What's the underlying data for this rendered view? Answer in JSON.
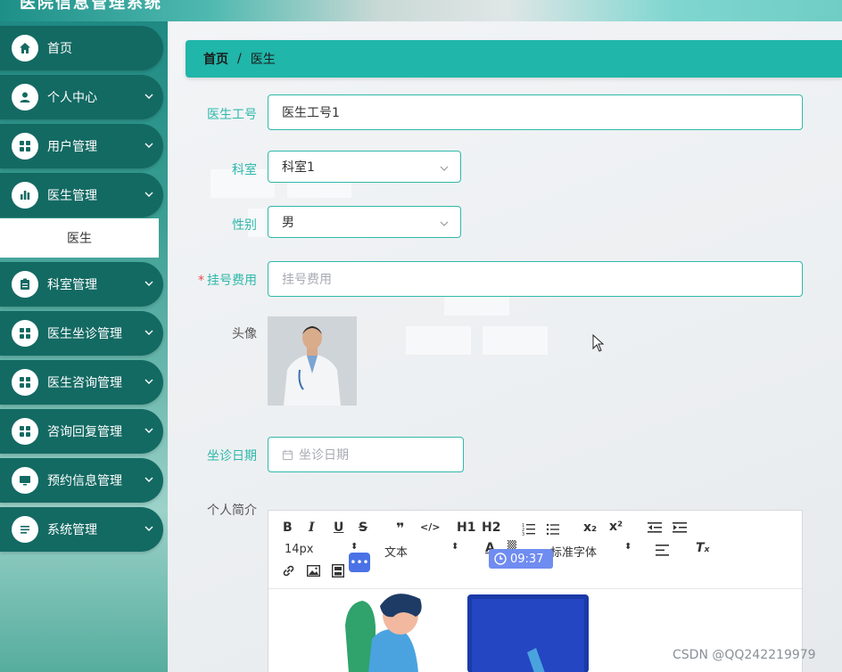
{
  "header": {
    "title": "医院信息管理系统"
  },
  "sidebar": {
    "items": [
      {
        "label": "首页",
        "icon": "home-icon",
        "has_submenu": false
      },
      {
        "label": "个人中心",
        "icon": "user-icon",
        "has_submenu": true
      },
      {
        "label": "用户管理",
        "icon": "grid-icon",
        "has_submenu": true
      },
      {
        "label": "医生管理",
        "icon": "bar-chart-icon",
        "has_submenu": true
      },
      {
        "label": "科室管理",
        "icon": "clipboard-icon",
        "has_submenu": true
      },
      {
        "label": "医生坐诊管理",
        "icon": "grid-icon",
        "has_submenu": true
      },
      {
        "label": "医生咨询管理",
        "icon": "grid-icon",
        "has_submenu": true
      },
      {
        "label": "咨询回复管理",
        "icon": "grid-icon",
        "has_submenu": true
      },
      {
        "label": "预约信息管理",
        "icon": "monitor-icon",
        "has_submenu": true
      },
      {
        "label": "系统管理",
        "icon": "list-icon",
        "has_submenu": true
      }
    ],
    "active_sub_item": "医生"
  },
  "breadcrumb": {
    "home": "首页",
    "separator": "/",
    "current": "医生"
  },
  "form": {
    "doctor_id": {
      "label": "医生工号",
      "value": "医生工号1"
    },
    "department": {
      "label": "科室",
      "value": "科室1"
    },
    "gender": {
      "label": "性别",
      "value": "男"
    },
    "fee": {
      "label": "挂号费用",
      "required_mark": "*",
      "placeholder": "挂号费用"
    },
    "avatar": {
      "label": "头像"
    },
    "visit_date": {
      "label": "坐诊日期",
      "placeholder": "坐诊日期"
    },
    "intro": {
      "label": "个人简介"
    }
  },
  "editor": {
    "font_size": "14px",
    "block_type": "文本",
    "font_family": "标准字体",
    "buttons": {
      "bold": "B",
      "italic": "I",
      "underline": "U",
      "strike": "S",
      "quote": "❞",
      "code": "</>",
      "h1": "H1",
      "h2": "H2",
      "subscript": "x₂",
      "superscript": "x²"
    }
  },
  "overlay": {
    "time": "09:37"
  },
  "watermark": "CSDN @QQ242219979",
  "colors": {
    "accent": "#2fb8ab",
    "sidebar_item": "#136a63",
    "breadcrumb": "#20b6a9"
  }
}
